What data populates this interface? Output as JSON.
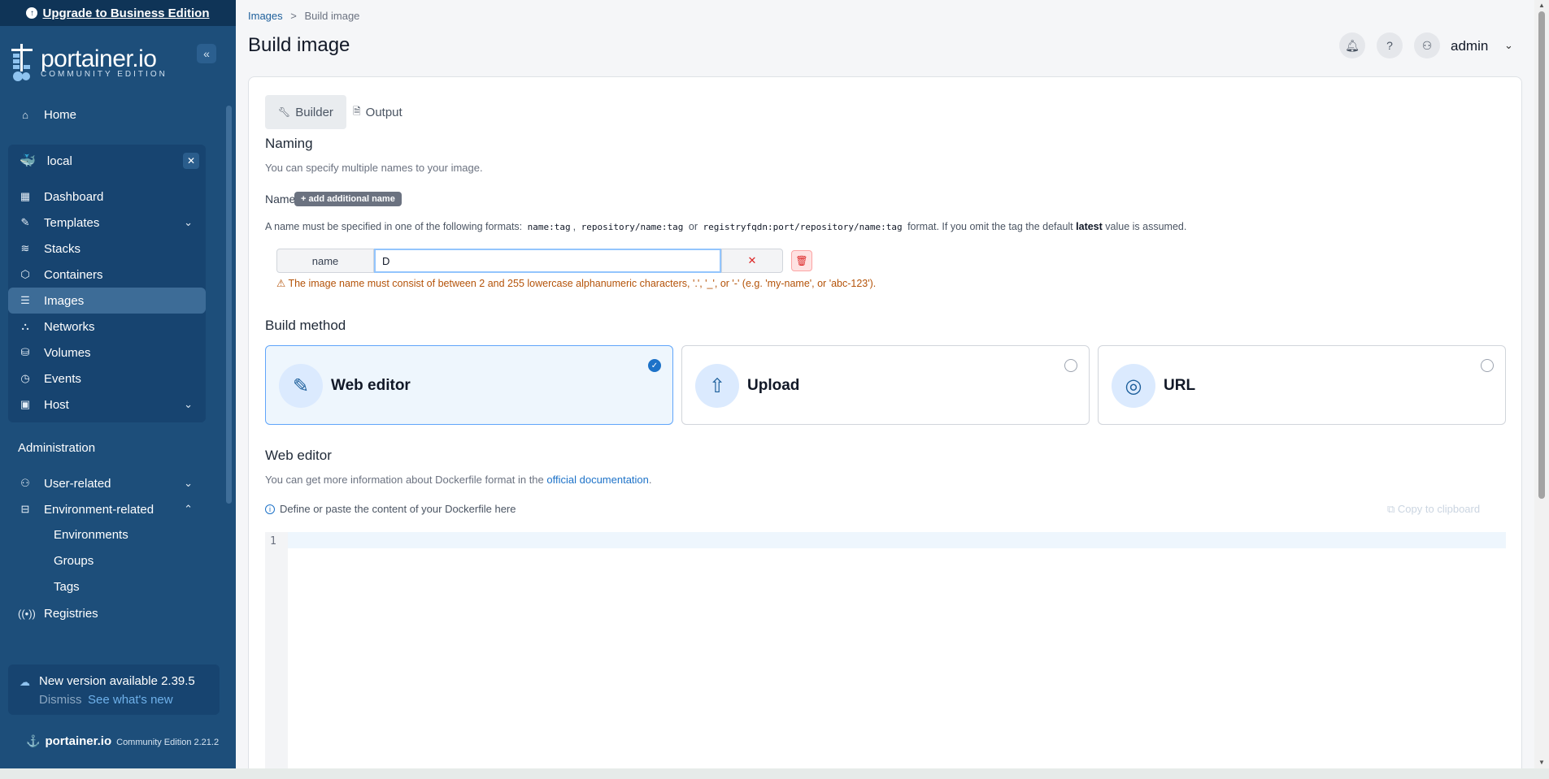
{
  "sidebar": {
    "upgrade_label": "Upgrade to Business Edition",
    "brand_name": "portainer.io",
    "brand_edition": "COMMUNITY EDITION",
    "home": "Home",
    "environment": "local",
    "env_items": [
      "Dashboard",
      "Templates",
      "Stacks",
      "Containers",
      "Images",
      "Networks",
      "Volumes",
      "Events",
      "Host"
    ],
    "admin_title": "Administration",
    "user_related": "User-related",
    "environment_related": "Environment-related",
    "env_sub": [
      "Environments",
      "Groups",
      "Tags"
    ],
    "registries": "Registries",
    "new_version": "New version available 2.39.5",
    "dismiss": "Dismiss",
    "see_whats_new": "See what's new",
    "footer_brand": "portainer.io",
    "footer_version": "Community Edition 2.21.2"
  },
  "header": {
    "breadcrumb_parent": "Images",
    "breadcrumb_sep": ">",
    "breadcrumb_current": "Build image",
    "title": "Build image",
    "user": "admin"
  },
  "tabs": {
    "builder": "Builder",
    "output": "Output"
  },
  "naming": {
    "title": "Naming",
    "help": "You can specify multiple names to your image.",
    "names_label": "Names",
    "add_name": "+ add additional name",
    "format_prefix": "A name must be specified in one of the following formats:",
    "format1": "name:tag",
    "sep1": ",",
    "format2": "repository/name:tag",
    "or": "or",
    "format3": "registryfqdn:port/repository/name:tag",
    "format_suffix1": "format. If you omit the tag the default",
    "latest": "latest",
    "format_suffix2": "value is assumed.",
    "field_label": "name",
    "field_value": "D",
    "error": "The image name must consist of between 2 and 255 lowercase alphanumeric characters, '.', '_', or '-' (e.g. 'my-name', or 'abc-123')."
  },
  "build_method": {
    "title": "Build method",
    "options": [
      "Web editor",
      "Upload",
      "URL"
    ],
    "selected": "Web editor"
  },
  "web_editor": {
    "title": "Web editor",
    "help_prefix": "You can get more information about Dockerfile format in the",
    "help_link": "official documentation",
    "help_suffix": ".",
    "define": "Define or paste the content of your Dockerfile here",
    "copy": "Copy to clipboard",
    "line_number": "1"
  },
  "colors": {
    "sidebar": "#1d4e7a",
    "accent": "#1d72c8",
    "error": "#b45309"
  }
}
